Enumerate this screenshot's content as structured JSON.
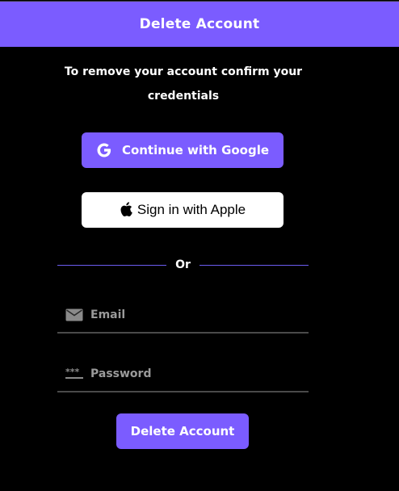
{
  "header": {
    "title": "Delete Account"
  },
  "instruction": {
    "line1": "To remove your account confirm your",
    "line2": "credentials"
  },
  "google_button": {
    "label": "Continue with Google",
    "icon": "google-g-icon"
  },
  "apple_button": {
    "label": "Sign in with Apple",
    "icon": "apple-logo-icon"
  },
  "divider": {
    "text": "Or"
  },
  "email_field": {
    "placeholder": "Email",
    "value": "",
    "icon": "mail-icon"
  },
  "password_field": {
    "placeholder": "Password",
    "value": "",
    "icon": "password-dots-icon"
  },
  "delete_button": {
    "label": "Delete Account"
  },
  "colors": {
    "accent": "#7b5cff",
    "background": "#000000",
    "divider_line": "#6b5cf0",
    "field_underline": "#4a4a4a",
    "placeholder": "#9a9a9a"
  }
}
